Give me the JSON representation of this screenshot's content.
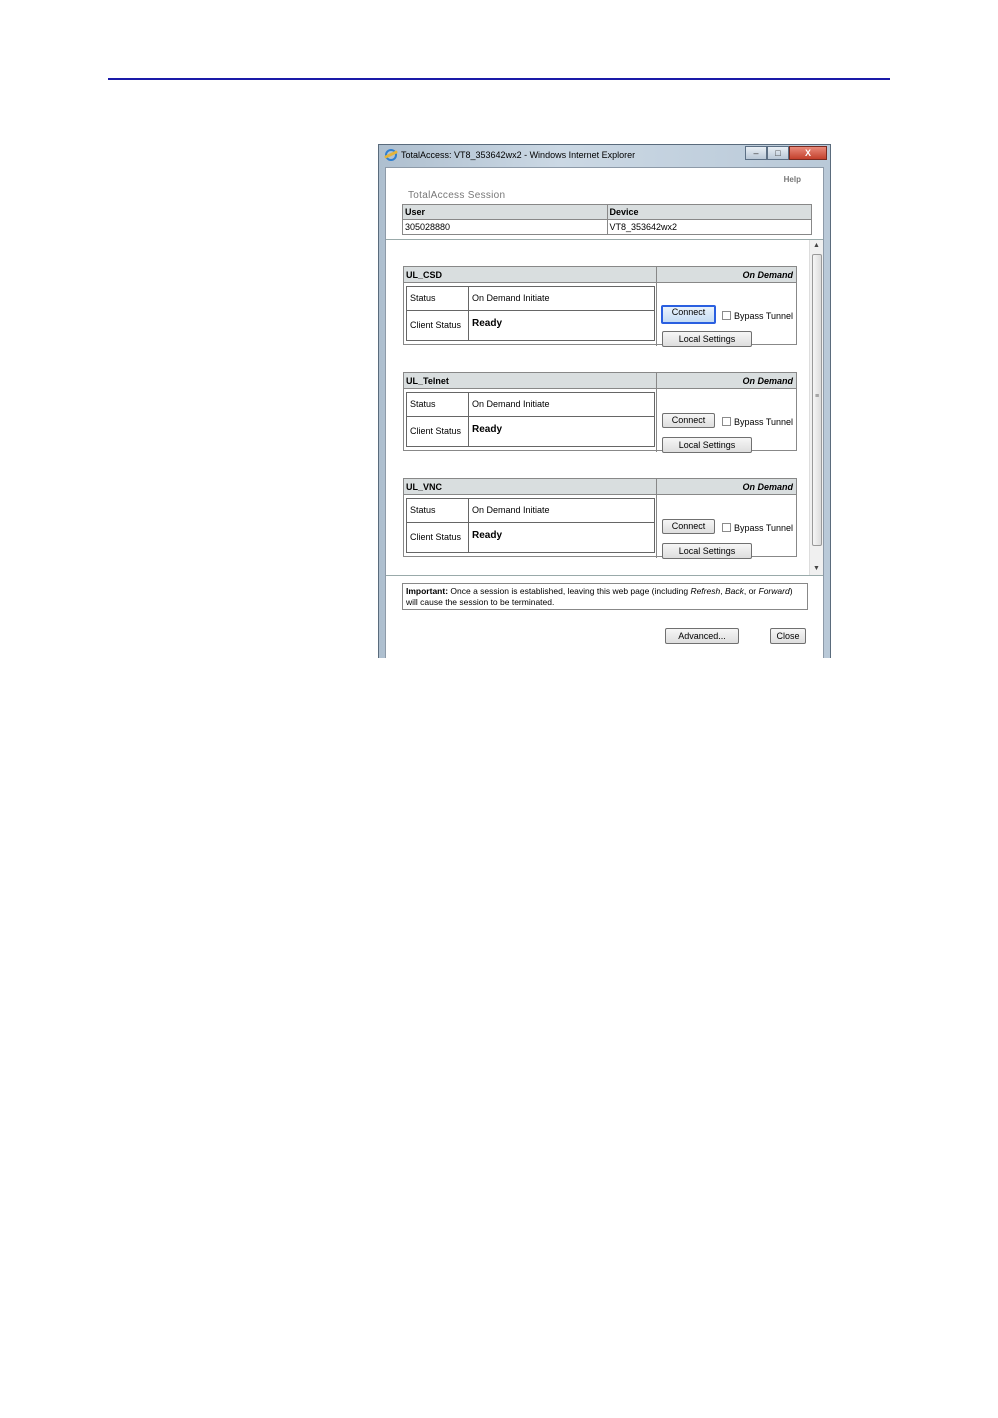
{
  "window": {
    "title": "TotalAccess: VT8_353642wx2 - Windows Internet Explorer",
    "minimize": "–",
    "maximize": "□",
    "close": "X"
  },
  "session": {
    "help_label": "Help",
    "title": "TotalAccess Session",
    "user_header": "User",
    "device_header": "Device",
    "user_value": "305028880",
    "device_value": "VT8_353642wx2"
  },
  "labels": {
    "status": "Status",
    "client_status": "Client Status",
    "connect": "Connect",
    "bypass_tunnel": "Bypass Tunnel",
    "local_settings": "Local Settings"
  },
  "connections": [
    {
      "name": "UL_CSD",
      "mode": "On Demand",
      "status": "On Demand Initiate",
      "client_status": "Ready"
    },
    {
      "name": "UL_Telnet",
      "mode": "On Demand",
      "status": "On Demand Initiate",
      "client_status": "Ready"
    },
    {
      "name": "UL_VNC",
      "mode": "On Demand",
      "status": "On Demand Initiate",
      "client_status": "Ready"
    }
  ],
  "notice": {
    "label": "Important:",
    "text_1": " Once a session is established, leaving this web page (including ",
    "refresh": "Refresh",
    "sep": ", ",
    "back": "Back",
    "or": ", or ",
    "forward": "Forward",
    "text_2": ") will cause the session to be terminated."
  },
  "footer": {
    "advanced": "Advanced...",
    "close": "Close"
  },
  "scrollbar": {
    "up": "▲",
    "down": "▼",
    "grip": "≡"
  }
}
